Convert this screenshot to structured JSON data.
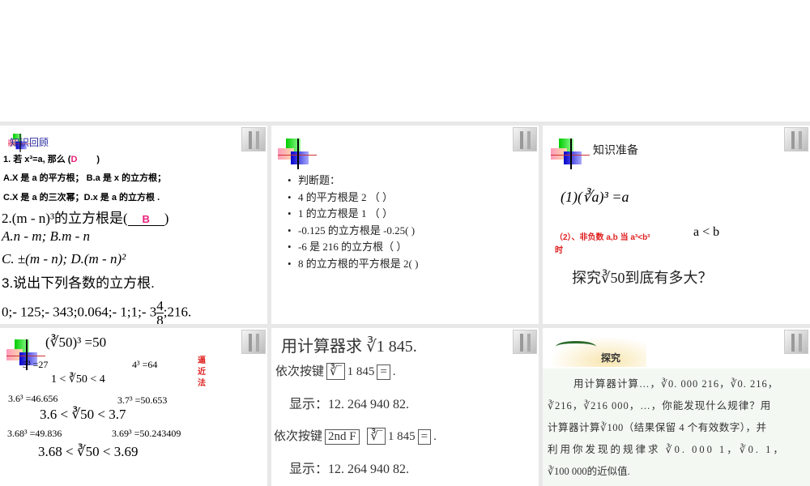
{
  "slides": [
    {
      "title": "知识回顾",
      "q1": "1. 若 x³=a, 那么 (",
      "q1_answer": "D",
      "q1_end": ")",
      "q1_opts": [
        "A.X 是 a 的平方根； B.a 是 x 的立方根；",
        "C.X 是 a 的三次幂；D.x 是 a 的立方根 ."
      ],
      "q2": "2.(m - n)³的立方根是(",
      "q2_answer": "B",
      "q2_end": ")",
      "q2_opts": [
        "A.n - m; B.m - n",
        "C. ±(m - n); D.(m - n)²"
      ],
      "q3": "3.说出下列各数的立方根.",
      "q3_nums": "0;- 125;- 343;0.064;- 1;1;- 3",
      "frac_num": "4",
      "frac_den": "8",
      "q3_end": ";216."
    },
    {
      "items": [
        "判断题：",
        "4 的平方根是 2 （  ）",
        "1 的立方根是 1 （   ）",
        "-0.125 的立方根是 -0.25(  )",
        "-6  是 216 的立方根（  ）",
        "8 的立方根的平方根是 2(  )"
      ]
    },
    {
      "title": "知识准备",
      "f1": "(1)(∛a)³ =a",
      "f2": "（2）、非负数 a,b 当 a³<b³",
      "f2_b": "a < b",
      "f2_c": "时",
      "f3": "探究∛50到底有多大？"
    },
    {
      "l1": "(∛50)³ =50",
      "l2a": "3³ =27",
      "l2b": "4³ =64",
      "side": [
        "逼",
        "近",
        "法"
      ],
      "l3": "1 < ∛50 < 4",
      "l4a": "3.6³ =46.656",
      "l4b": "3.7³ =50.653",
      "l5": "3.6 < ∛50 < 3.7",
      "l6a": "3.68³ =49.836",
      "l6b": "3.69³ =50.243409",
      "l7": "3.68 < ∛50 < 3.69"
    },
    {
      "title": "用计算器求 ∛1 845.",
      "seq_label": "依次按键",
      "key_root": "∛‾",
      "num": "1 845",
      "key_eq": "=",
      "display": "显示：12. 264 940 82.",
      "key_2nd": "2nd F"
    },
    {
      "title": "探究",
      "lines": [
        "用计算器计算…，∛0. 000 216，∛0. 216，",
        "∛216，∛216 000，…，你能发现什么规律？用",
        "计算器计算∛100（结果保留 4 个有效数字），并",
        "利用你发现的规律求 ∛0. 000 1，∛0. 1，",
        "∛100 000的近似值."
      ]
    }
  ]
}
